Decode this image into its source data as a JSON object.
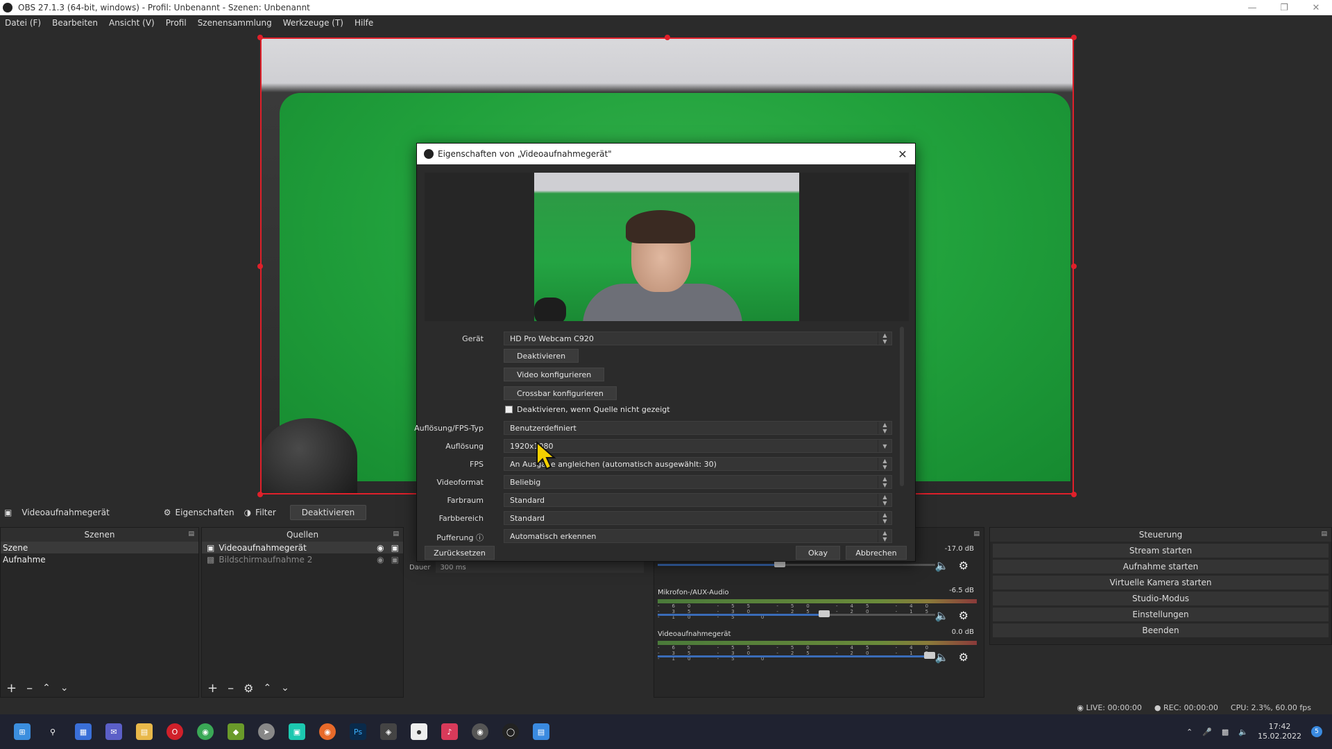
{
  "window": {
    "title": "OBS 27.1.3 (64-bit, windows) - Profil: Unbenannt - Szenen: Unbenannt"
  },
  "menu": [
    "Datei (F)",
    "Bearbeiten",
    "Ansicht (V)",
    "Profil",
    "Szenensammlung",
    "Werkzeuge (T)",
    "Hilfe"
  ],
  "source_toolbar": {
    "source": "Videoaufnahmegerät",
    "properties": "Eigenschaften",
    "filter": "Filter",
    "deactivate": "Deaktivieren"
  },
  "scenes": {
    "title": "Szenen",
    "items": [
      "Szene",
      "Aufnahme"
    ]
  },
  "sources": {
    "title": "Quellen",
    "items": [
      "Videoaufnahmegerät",
      "Bildschirmaufnahme 2"
    ]
  },
  "transition": {
    "duration_label": "Dauer",
    "duration_value": "300 ms"
  },
  "mixer": {
    "channels": [
      {
        "name": "",
        "db": "-17.0 dB",
        "volume": 0.44
      },
      {
        "name": "Mikrofon-/AUX-Audio",
        "db": "-6.5 dB",
        "volume": 0.6
      },
      {
        "name": "Videoaufnahmegerät",
        "db": "0.0 dB",
        "volume": 0.98
      }
    ],
    "tick_labels": "-60 -55 -50 -45 -40 -35 -30 -25 -20 -15 -10 -5 0"
  },
  "controls": {
    "title": "Steuerung",
    "buttons": [
      "Stream starten",
      "Aufnahme starten",
      "Virtuelle Kamera starten",
      "Studio-Modus",
      "Einstellungen",
      "Beenden"
    ]
  },
  "status": {
    "live": "LIVE: 00:00:00",
    "rec": "REC: 00:00:00",
    "cpu": "CPU: 2.3%, 60.00 fps"
  },
  "taskbar": {
    "time": "17:42",
    "date": "15.02.2022",
    "badge": "5"
  },
  "dialog": {
    "title": "Eigenschaften von „Videoaufnahmegerät\"",
    "device_label": "Gerät",
    "device_value": "HD Pro Webcam C920",
    "btn_deactivate": "Deaktivieren",
    "btn_video_config": "Video konfigurieren",
    "btn_crossbar": "Crossbar konfigurieren",
    "check_label": "Deaktivieren, wenn Quelle nicht gezeigt",
    "res_type_label": "Auflösung/FPS-Typ",
    "res_type_value": "Benutzerdefiniert",
    "res_label": "Auflösung",
    "res_value": "1920x1080",
    "fps_label": "FPS",
    "fps_value": "An Ausgabe angleichen (automatisch ausgewählt: 30)",
    "format_label": "Videoformat",
    "format_value": "Beliebig",
    "colorspace_label": "Farbraum",
    "colorspace_value": "Standard",
    "colorrange_label": "Farbbereich",
    "colorrange_value": "Standard",
    "buffer_label": "Pufferung",
    "buffer_value": "Automatisch erkennen",
    "reset": "Zurücksetzen",
    "ok": "Okay",
    "cancel": "Abbrechen"
  }
}
